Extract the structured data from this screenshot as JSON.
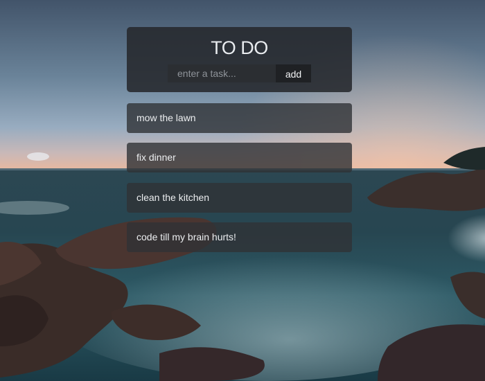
{
  "app": {
    "title": "TO DO"
  },
  "task_form": {
    "placeholder": "enter a task...",
    "add_label": "add"
  },
  "tasks": [
    {
      "label": "mow the lawn"
    },
    {
      "label": "fix dinner"
    },
    {
      "label": "clean the kitchen"
    },
    {
      "label": "code till my brain hurts!"
    }
  ],
  "colors": {
    "card_background": "#26282c",
    "task_background": "#303236",
    "text": "#eceef0",
    "button_background": "#1f2124"
  }
}
